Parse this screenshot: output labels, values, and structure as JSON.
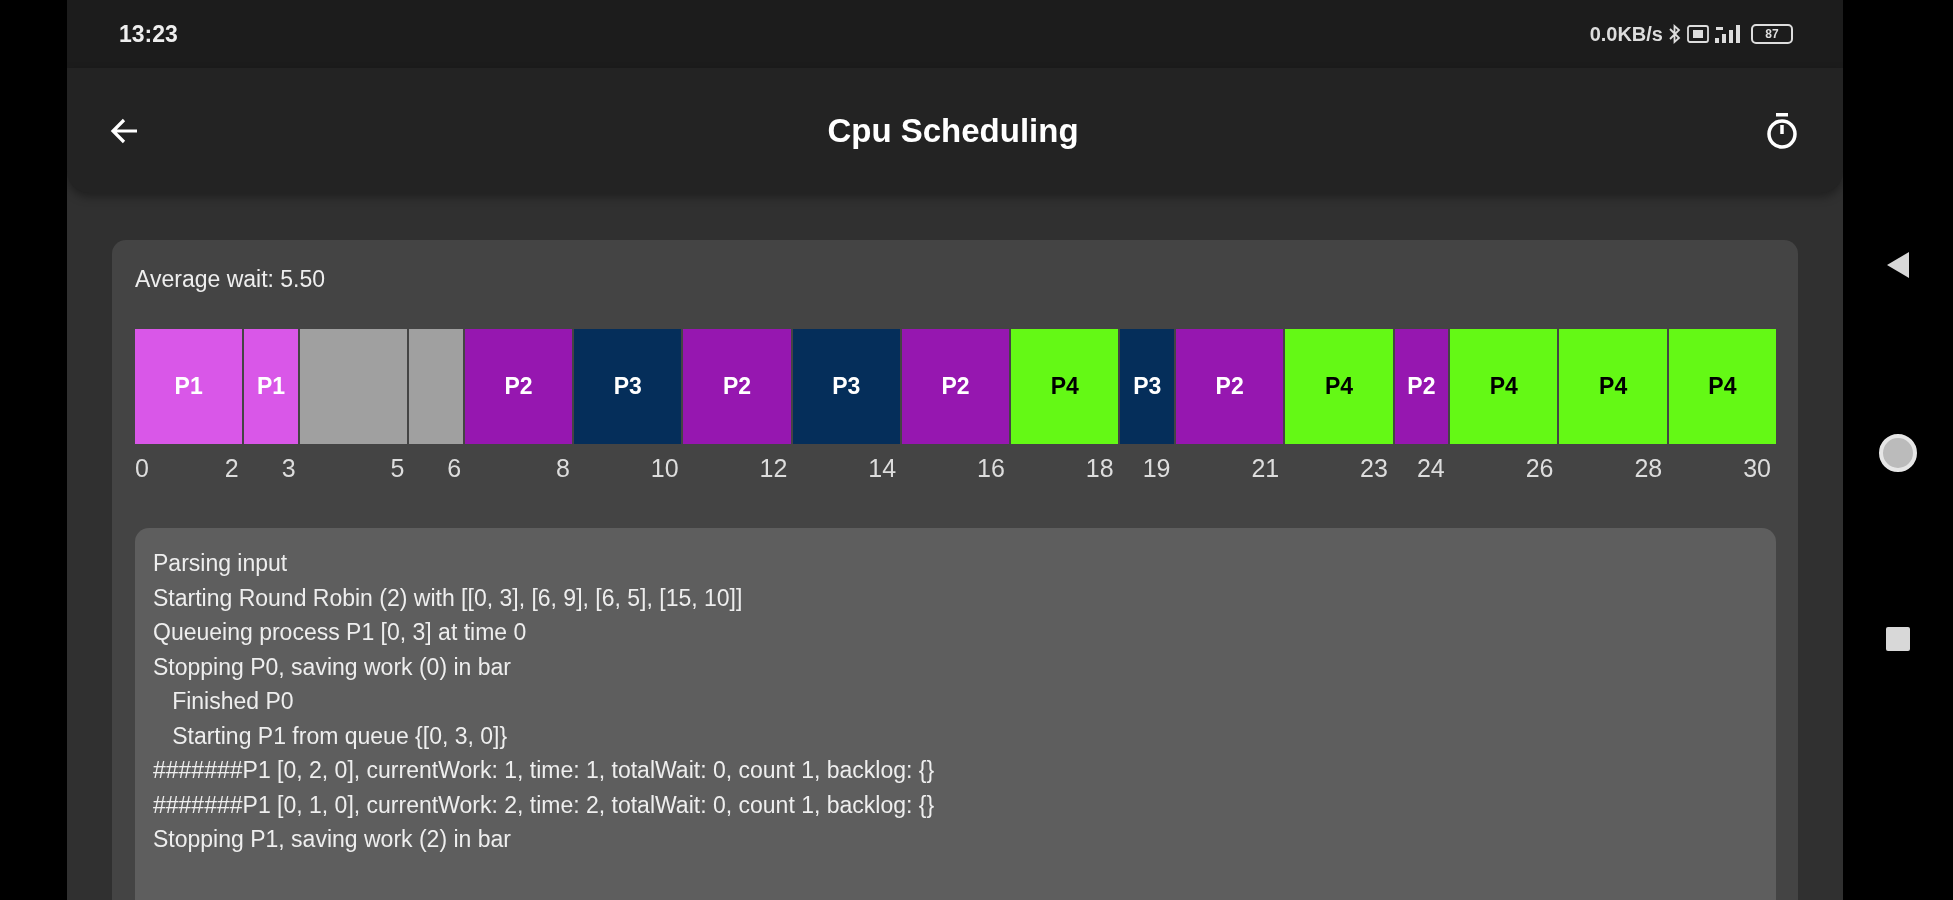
{
  "status_bar": {
    "time": "13:23",
    "net_speed": "0.0KB/s",
    "battery": "87"
  },
  "app_bar": {
    "title": "Cpu Scheduling"
  },
  "summary": {
    "average_wait": "Average wait: 5.50"
  },
  "gantt": {
    "start": "0",
    "segments": [
      {
        "label": "P1",
        "color": "#d957e8",
        "end": "2"
      },
      {
        "label": "P1",
        "color": "#d957e8",
        "end": "3"
      },
      {
        "color": "#a0a0a0",
        "end": "5"
      },
      {
        "color": "#a0a0a0",
        "end": "6"
      },
      {
        "label": "P2",
        "color": "#9617b0",
        "end": "8"
      },
      {
        "label": "P3",
        "color": "#052e5a",
        "end": "10"
      },
      {
        "label": "P2",
        "color": "#9617b0",
        "end": "12"
      },
      {
        "label": "P3",
        "color": "#052e5a",
        "end": "14"
      },
      {
        "label": "P2",
        "color": "#9617b0",
        "end": "16"
      },
      {
        "label": "P4",
        "color": "#64f915",
        "end": "18"
      },
      {
        "label": "P3",
        "color": "#052e5a",
        "end": "19"
      },
      {
        "label": "P2",
        "color": "#9617b0",
        "end": "21"
      },
      {
        "label": "P4",
        "color": "#64f915",
        "end": "23"
      },
      {
        "label": "P2",
        "color": "#9617b0",
        "end": "24"
      },
      {
        "label": "P4",
        "color": "#64f915",
        "end": "26"
      },
      {
        "label": "P4",
        "color": "#64f915",
        "end": "28"
      },
      {
        "label": "P4",
        "color": "#64f915",
        "end": "30"
      }
    ]
  },
  "log": [
    "Parsing input",
    "Starting Round Robin (2) with [[0, 3], [6, 9], [6, 5], [15, 10]]",
    "Queueing process P1 [0, 3] at time 0",
    "Stopping P0, saving work (0) in bar",
    "   Finished P0",
    "   Starting P1 from queue {[0, 3, 0]}",
    "#######P1 [0, 2, 0], currentWork: 1, time: 1, totalWait: 0, count 1, backlog: {}",
    "#######P1 [0, 1, 0], currentWork: 2, time: 2, totalWait: 0, count 1, backlog: {}",
    "Stopping P1, saving work (2) in bar"
  ]
}
